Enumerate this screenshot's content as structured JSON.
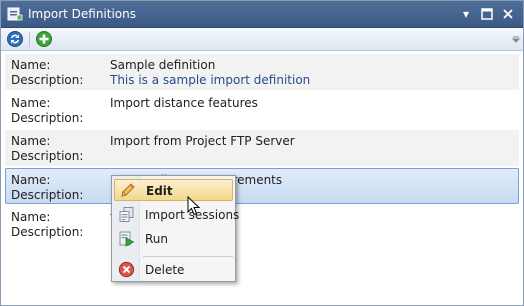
{
  "window": {
    "title": "Import Definitions",
    "controls": {
      "pin_glyph": "▾",
      "maximize_glyph": "▫",
      "close_glyph": "✕"
    }
  },
  "toolbar": {
    "buttons": [
      {
        "icon": "refresh-icon",
        "color": "#2f6fb8"
      },
      {
        "icon": "add-icon",
        "color": "#3aa53a"
      }
    ]
  },
  "list": {
    "name_label": "Name:",
    "description_label": "Description:",
    "items": [
      {
        "name": "Sample definition",
        "description": "This is a sample import definition"
      },
      {
        "name": "Import distance features",
        "description": ""
      },
      {
        "name": "Import from Project FTP Server",
        "description": ""
      },
      {
        "name": "Import all 3D measurements",
        "description": ""
      },
      {
        "name": "t",
        "description": ""
      }
    ]
  },
  "context_menu": {
    "items": [
      {
        "label": "Edit",
        "icon": "pencil-icon"
      },
      {
        "label": "Import sessions",
        "icon": "sessions-icon"
      },
      {
        "label": "Run",
        "icon": "run-icon"
      },
      {
        "label": "Delete",
        "icon": "delete-icon"
      }
    ]
  },
  "colors": {
    "titlebar": "#3b5a85",
    "selection": "#c7dbf3",
    "menu_hover": "#f4d78c",
    "description_text": "#2a4a8c"
  }
}
